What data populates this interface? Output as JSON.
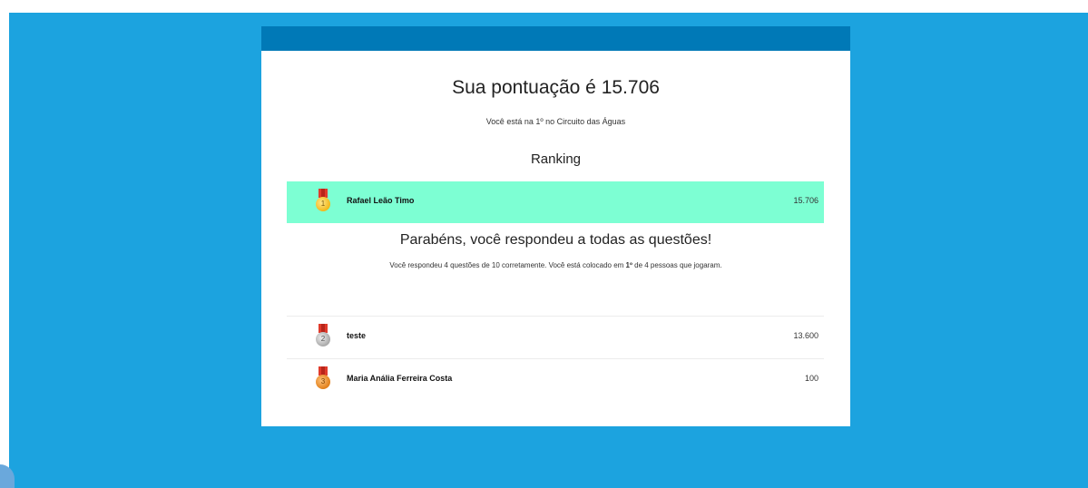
{
  "score": {
    "title": "Sua pontuação é 15.706",
    "circuit_text": "Você está na 1º no Circuito das Águas"
  },
  "ranking": {
    "title": "Ranking",
    "rows": [
      {
        "position": "1",
        "medal": "gold-medal-icon",
        "name": "Rafael Leão Timo",
        "score": "15.706"
      },
      {
        "position": "2",
        "medal": "silver-medal-icon",
        "name": "teste",
        "score": "13.600"
      },
      {
        "position": "3",
        "medal": "bronze-medal-icon",
        "name": "Maria Anália Ferreira Costa",
        "score": "100"
      }
    ]
  },
  "result": {
    "congrats": "Parabéns, você respondeu a todas as questões!",
    "summary_before": "Você respondeu 4 questões de 10 corretamente. Você está colocado em ",
    "summary_place": "1º",
    "summary_after": " de 4 pessoas que jogaram."
  },
  "colors": {
    "background": "#1ca3df",
    "header": "#0079b7",
    "highlight": "#7dffd3"
  }
}
